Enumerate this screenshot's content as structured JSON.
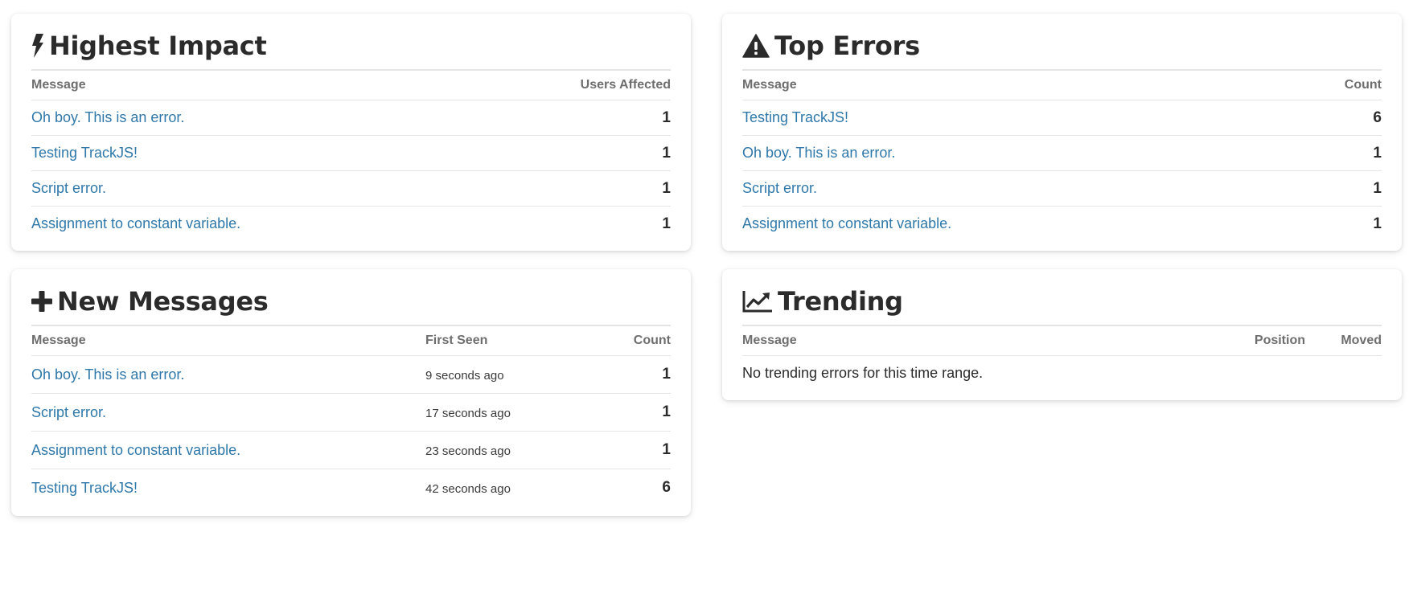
{
  "panels": {
    "highest_impact": {
      "title": "Highest Impact",
      "icon": "bolt-icon",
      "columns": [
        "Message",
        "Users Affected"
      ],
      "rows": [
        {
          "message": "Oh boy. This is an error.",
          "value": "1"
        },
        {
          "message": "Testing TrackJS!",
          "value": "1"
        },
        {
          "message": "Script error.",
          "value": "1"
        },
        {
          "message": "Assignment to constant variable.",
          "value": "1"
        }
      ]
    },
    "top_errors": {
      "title": "Top Errors",
      "icon": "warning-icon",
      "columns": [
        "Message",
        "Count"
      ],
      "rows": [
        {
          "message": "Testing TrackJS!",
          "value": "6"
        },
        {
          "message": "Oh boy. This is an error.",
          "value": "1"
        },
        {
          "message": "Script error.",
          "value": "1"
        },
        {
          "message": "Assignment to constant variable.",
          "value": "1"
        }
      ]
    },
    "new_messages": {
      "title": "New Messages",
      "icon": "plus-icon",
      "columns": [
        "Message",
        "First Seen",
        "Count"
      ],
      "rows": [
        {
          "message": "Oh boy. This is an error.",
          "first_seen": "9 seconds ago",
          "value": "1"
        },
        {
          "message": "Script error.",
          "first_seen": "17 seconds ago",
          "value": "1"
        },
        {
          "message": "Assignment to constant variable.",
          "first_seen": "23 seconds ago",
          "value": "1"
        },
        {
          "message": "Testing TrackJS!",
          "first_seen": "42 seconds ago",
          "value": "6"
        }
      ]
    },
    "trending": {
      "title": "Trending",
      "icon": "line-chart-icon",
      "columns": [
        "Message",
        "Position",
        "Moved"
      ],
      "empty_text": "No trending errors for this time range."
    }
  },
  "colors": {
    "link": "#2f78aa",
    "heading": "#2b2b2b",
    "column_header": "#6e6e6e",
    "divider": "#e4e4e4"
  }
}
